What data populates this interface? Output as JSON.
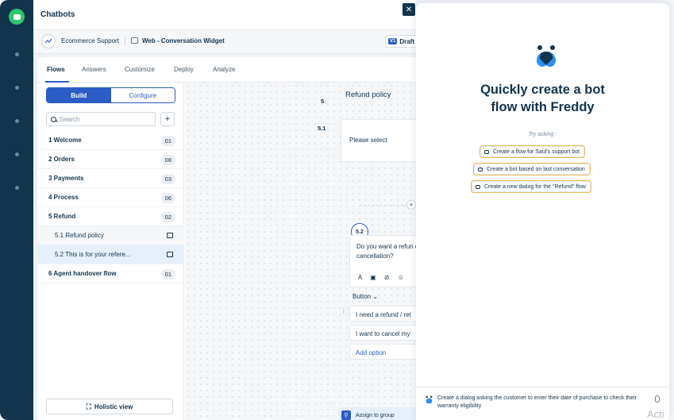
{
  "app": {
    "title": "Chatbots"
  },
  "subbar": {
    "bot_name": "Ecommerce Support",
    "widget_name": "Web - Conversation Widget",
    "version": "V1",
    "status": "Draft"
  },
  "tabs": [
    "Flows",
    "Answers",
    "Customize",
    "Deploy",
    "Analyze"
  ],
  "left": {
    "build_label": "Build",
    "configure_label": "Configure",
    "search_placeholder": "Search",
    "flows": [
      {
        "label": "1 Welcome",
        "count": "01"
      },
      {
        "label": "2 Orders",
        "count": "08"
      },
      {
        "label": "3 Payments",
        "count": "03"
      },
      {
        "label": "4 Process",
        "count": "06"
      },
      {
        "label": "5 Refund",
        "count": "02"
      },
      {
        "label": "5.1 Refund policy"
      },
      {
        "label": "5.2 This is for your refere..."
      },
      {
        "label": "6 Agent handover flow",
        "count": "01"
      }
    ],
    "holistic_label": "Holistic view"
  },
  "canvas": {
    "step5_badge": "5",
    "step5_title": "Refund policy",
    "step51_badge": "5.1",
    "step51_text": "Please select",
    "step52_badge": "5.2",
    "step52_message": "Do you want a refun or cancellation?",
    "format_icons": "A ▣ ⊘ ☺",
    "button_label": "Button ⌄",
    "options": [
      "I need a refund / ret",
      "I want to cancel my"
    ],
    "add_option": "Add option",
    "assign_label": "Assign to group"
  },
  "freddy": {
    "heading_line1": "Quickly create a bot",
    "heading_line2": "flow with Freddy",
    "try_asking": "Try asking :",
    "suggestions": [
      "Create a flow for Saul's support bot",
      "Create a bot based on last conversation",
      "Create a new dialog for the \"Refund\" flow"
    ],
    "prompt_text": "Create a dialog asking the customer to enter their date of purchase to check their warranty eligibility"
  },
  "watermark": "Acti",
  "colors": {
    "brand_navy": "#12344d",
    "accent_blue": "#2c5cc5",
    "rail_green": "#2ec56b",
    "suggestion_border": "#f1b94a"
  }
}
